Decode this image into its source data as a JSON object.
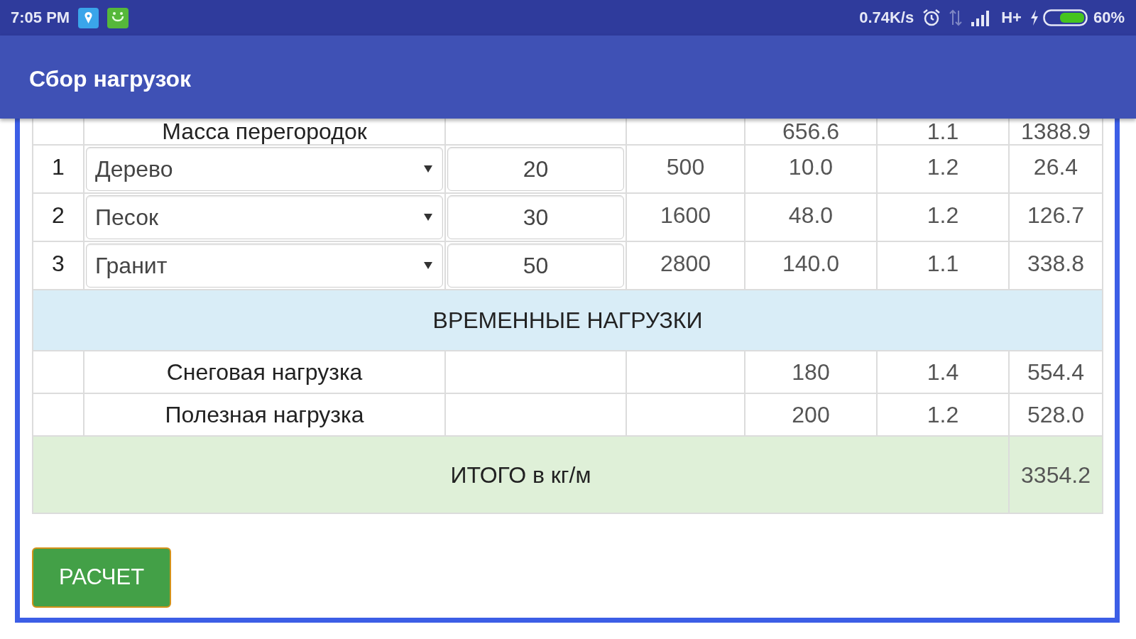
{
  "status_bar": {
    "time": "7:05 PM",
    "net_speed": "0.74K/s",
    "network_type": "H+",
    "battery": "60%"
  },
  "app_bar": {
    "title": "Сбор нагрузок"
  },
  "table": {
    "rows": [
      {
        "kind": "partial",
        "label": "Масса перегородок",
        "cells": [
          "656.6",
          "1.1",
          "1388.9"
        ]
      },
      {
        "kind": "material",
        "number": "1",
        "select_value": "Дерево",
        "input_value": "20",
        "cells": [
          "500",
          "10.0",
          "1.2",
          "26.4"
        ]
      },
      {
        "kind": "material",
        "number": "2",
        "select_value": "Песок",
        "input_value": "30",
        "cells": [
          "1600",
          "48.0",
          "1.2",
          "126.7"
        ]
      },
      {
        "kind": "material",
        "number": "3",
        "select_value": "Гранит",
        "input_value": "50",
        "cells": [
          "2800",
          "140.0",
          "1.1",
          "338.8"
        ]
      },
      {
        "kind": "section",
        "label": "ВРЕМЕННЫЕ НАГРУЗКИ"
      },
      {
        "kind": "load",
        "label": "Снеговая нагрузка",
        "cells": [
          "180",
          "1.4",
          "554.4"
        ]
      },
      {
        "kind": "load",
        "label": "Полезная нагрузка",
        "cells": [
          "200",
          "1.2",
          "528.0"
        ]
      },
      {
        "kind": "total",
        "label": "ИТОГО в кг/м",
        "value": "3354.2"
      }
    ]
  },
  "button": "РАСЧЕТ"
}
